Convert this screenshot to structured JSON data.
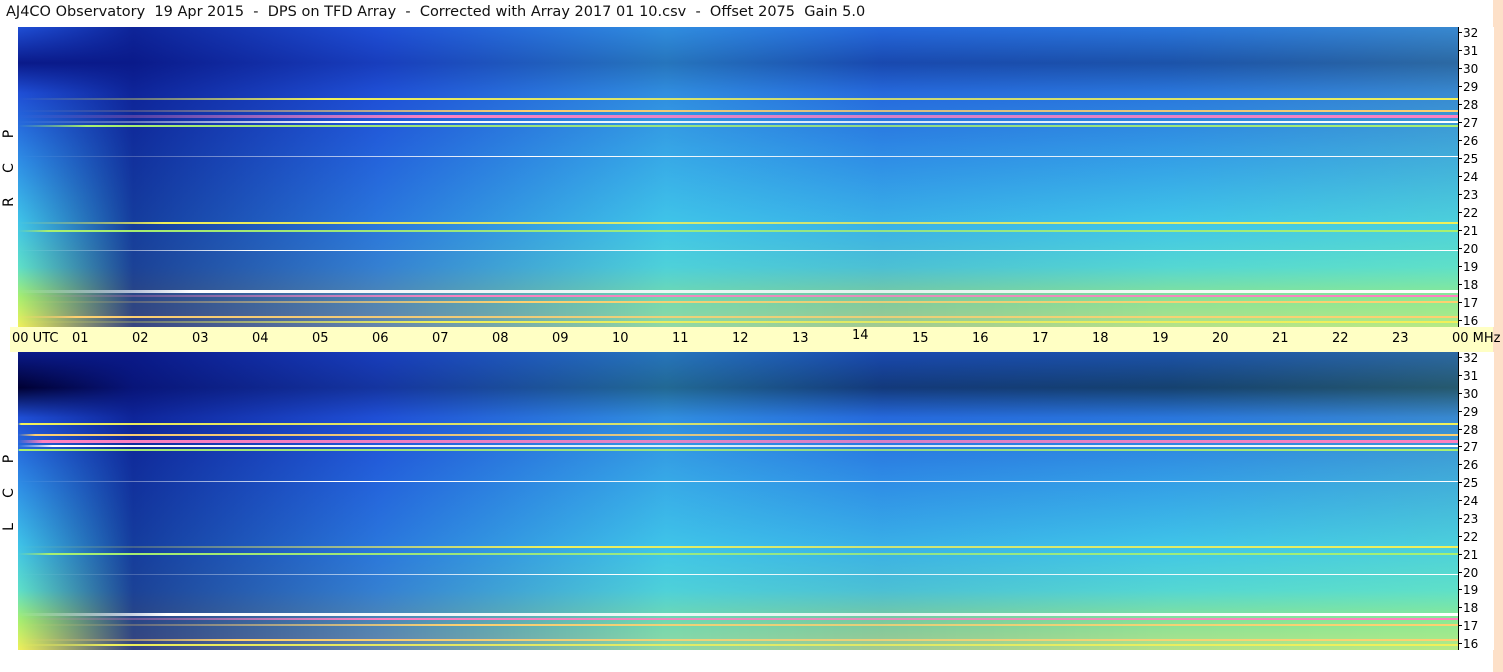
{
  "header": {
    "title": "AJ4CO Observatory  19 Apr 2015  -  DPS on TFD Array  -  Corrected with Array 2017 01 10.csv  -  Offset 2075  Gain 5.0"
  },
  "chart_data": [
    {
      "type": "heatmap",
      "polarization_label": [
        "R",
        "C",
        "P"
      ],
      "x_tick_labels": [
        "00 UTC",
        "01",
        "02",
        "03",
        "04",
        "05",
        "06",
        "07",
        "08",
        "09",
        "10",
        "11",
        "12",
        "13",
        "14",
        "15",
        "16",
        "17",
        "18",
        "19",
        "20",
        "21",
        "22",
        "23",
        "00 MHz"
      ],
      "y_tick_labels": [
        "32",
        "31",
        "30",
        "29",
        "28",
        "27",
        "26",
        "25",
        "24",
        "23",
        "22",
        "21",
        "20",
        "19",
        "18",
        "17",
        "16"
      ],
      "ylim": [
        16,
        32
      ],
      "xlim_utc_hours": [
        0,
        24
      ],
      "colormap": [
        "#000033",
        "#0a1a8a",
        "#1f4fd6",
        "#2f8fe6",
        "#3fc4e8",
        "#5fe0c8",
        "#a8f070",
        "#f0f05a",
        "#ffd070",
        "#ff80c0",
        "#ffffff"
      ]
    },
    {
      "type": "heatmap",
      "polarization_label": [
        "L",
        "C",
        "P"
      ],
      "y_tick_labels": [
        "32",
        "31",
        "30",
        "29",
        "28",
        "27",
        "26",
        "25",
        "24",
        "23",
        "22",
        "21",
        "20",
        "19",
        "18",
        "17",
        "16"
      ],
      "ylim": [
        16,
        32
      ],
      "xlim_utc_hours": [
        0,
        24
      ],
      "colormap": [
        "#000033",
        "#0a1a8a",
        "#1f4fd6",
        "#2f8fe6",
        "#3fc4e8",
        "#5fe0c8",
        "#a8f070",
        "#f0f05a",
        "#ffd070",
        "#ff80c0",
        "#ffffff"
      ]
    }
  ],
  "colors": {
    "time_strip": "#ffffc4",
    "right_edge": "#fde0c8"
  }
}
